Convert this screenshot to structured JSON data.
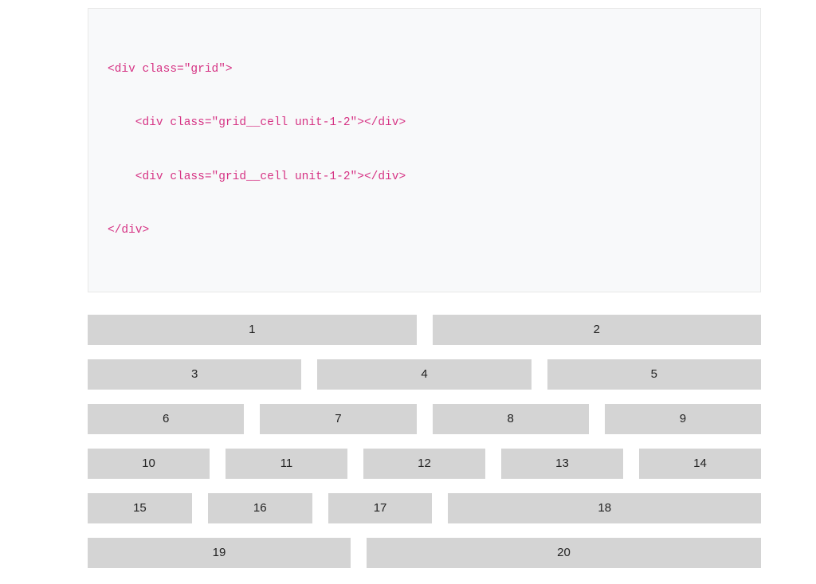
{
  "code": {
    "line1": "<div class=\"grid\">",
    "line2": "    <div class=\"grid__cell unit-1-2\"></div>",
    "line3": "    <div class=\"grid__cell unit-1-2\"></div>",
    "line4": "</div>"
  },
  "grid": {
    "rows": [
      {
        "cells": [
          "1",
          "2"
        ]
      },
      {
        "cells": [
          "3",
          "4",
          "5"
        ]
      },
      {
        "cells": [
          "6",
          "7",
          "8",
          "9"
        ]
      },
      {
        "cells": [
          "10",
          "11",
          "12",
          "13",
          "14"
        ]
      },
      {
        "cells": [
          "15",
          "16",
          "17",
          "18"
        ],
        "grow": [
          1,
          1,
          1,
          3
        ]
      },
      {
        "cells": [
          "19",
          "20"
        ],
        "grow": [
          2,
          3
        ]
      }
    ]
  }
}
